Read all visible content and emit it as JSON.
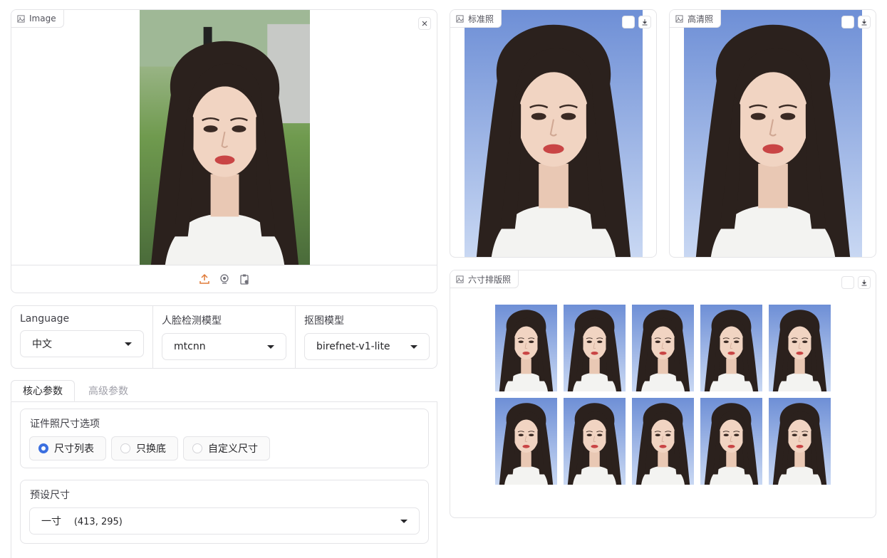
{
  "input_panel": {
    "label": "Image",
    "close_icon": "close-icon",
    "toolbar_icons": [
      "upload-icon",
      "webcam-icon",
      "clipboard-icon"
    ]
  },
  "standard_panel": {
    "label": "标准照"
  },
  "hd_panel": {
    "label": "高清照"
  },
  "layout_panel": {
    "label": "六寸排版照",
    "rows": 2,
    "cols": 5
  },
  "dropdowns": [
    {
      "label": "Language",
      "value": "中文"
    },
    {
      "label": "人脸检测模型",
      "value": "mtcnn"
    },
    {
      "label": "抠图模型",
      "value": "birefnet-v1-lite"
    }
  ],
  "tabs": [
    {
      "label": "核心参数",
      "active": true
    },
    {
      "label": "高级参数",
      "active": false
    }
  ],
  "size_options": {
    "title": "证件照尺寸选项",
    "options": [
      {
        "label": "尺寸列表",
        "selected": true
      },
      {
        "label": "只换底",
        "selected": false
      },
      {
        "label": "自定义尺寸",
        "selected": false
      }
    ]
  },
  "preset_size": {
    "title": "预设尺寸",
    "value": "一寸",
    "dims": "(413, 295)"
  },
  "colors": {
    "accent": "#3b6fe0",
    "upload_orange": "#e07b39",
    "id_bg_top": "#6e8fd6",
    "id_bg_bottom": "#c7d6f2"
  }
}
